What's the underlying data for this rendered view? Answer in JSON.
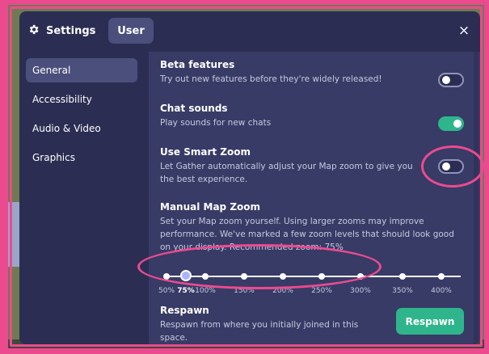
{
  "header": {
    "settings_label": "Settings",
    "user_tab_label": "User",
    "close_glyph": "×"
  },
  "sidebar": {
    "items": [
      {
        "label": "General",
        "active": true
      },
      {
        "label": "Accessibility",
        "active": false
      },
      {
        "label": "Audio & Video",
        "active": false
      },
      {
        "label": "Graphics",
        "active": false
      }
    ]
  },
  "settings": {
    "beta": {
      "title": "Beta features",
      "desc": "Try out new features before they're widely released!",
      "enabled": false
    },
    "chat_sounds": {
      "title": "Chat sounds",
      "desc": "Play sounds for new chats",
      "enabled": true
    },
    "smart_zoom": {
      "title": "Use Smart Zoom",
      "desc_line1": "Let Gather automatically adjust your Map zoom to give you",
      "desc_line2": "the best experience.",
      "enabled": false
    },
    "manual_zoom": {
      "title": "Manual Map Zoom",
      "desc_line1": "Set your Map zoom yourself. Using larger zooms may improve",
      "desc_line2": "performance. We've marked a few zoom levels that should look good",
      "desc_line3": "on your display. Recommended zoom: 75%",
      "levels": [
        "50%",
        "75%",
        "100%",
        "150%",
        "200%",
        "250%",
        "300%",
        "350%",
        "400%"
      ],
      "selected_level": "75%"
    },
    "respawn": {
      "title": "Respawn",
      "desc_line1": "Respawn from where you initially joined in this",
      "desc_line2": "space.",
      "button_label": "Respawn"
    }
  },
  "colors": {
    "modal_bg": "#2b2e52",
    "content_bg": "#373b66",
    "accent_green": "#2fb58b",
    "annotation_pink": "#ec4a8f"
  },
  "icons": {
    "settings": "gear-icon",
    "close": "close-icon"
  }
}
